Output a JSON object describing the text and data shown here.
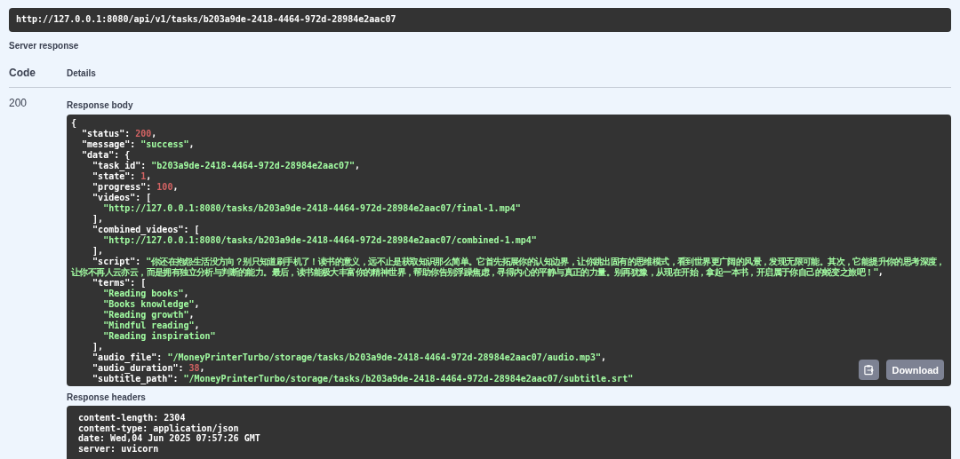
{
  "request_url": {
    "value": "http://127.0.0.1:8080/api/v1/tasks/b203a9de-2418-4464-972d-28984e2aac07"
  },
  "server_response": {
    "title": "Server response",
    "columns": [
      "Code",
      "Details"
    ],
    "code": "200",
    "response_body": {
      "label": "Response body",
      "lines": [
        [
          {
            "kind": "plain",
            "text": "{"
          }
        ],
        [
          {
            "kind": "plain",
            "text": "  \"status\": "
          },
          {
            "kind": "number",
            "text": "200"
          },
          {
            "kind": "plain",
            "text": ","
          }
        ],
        [
          {
            "kind": "plain",
            "text": "  \"message\": "
          },
          {
            "kind": "string",
            "text": "\"success\""
          },
          {
            "kind": "plain",
            "text": ","
          }
        ],
        [
          {
            "kind": "plain",
            "text": "  \"data\": {"
          }
        ],
        [
          {
            "kind": "plain",
            "text": "    \"task_id\": "
          },
          {
            "kind": "string",
            "text": "\"b203a9de-2418-4464-972d-28984e2aac07\""
          },
          {
            "kind": "plain",
            "text": ","
          }
        ],
        [
          {
            "kind": "plain",
            "text": "    \"state\": "
          },
          {
            "kind": "number",
            "text": "1"
          },
          {
            "kind": "plain",
            "text": ","
          }
        ],
        [
          {
            "kind": "plain",
            "text": "    \"progress\": "
          },
          {
            "kind": "number",
            "text": "100"
          },
          {
            "kind": "plain",
            "text": ","
          }
        ],
        [
          {
            "kind": "plain",
            "text": "    \"videos\": ["
          }
        ],
        [
          {
            "kind": "string",
            "text": "      \"http://127.0.0.1:8080/tasks/b203a9de-2418-4464-972d-28984e2aac07/final-1.mp4\""
          }
        ],
        [
          {
            "kind": "plain",
            "text": "    ],"
          }
        ],
        [
          {
            "kind": "plain",
            "text": "    \"combined_videos\": ["
          }
        ],
        [
          {
            "kind": "string",
            "text": "      \"http://127.0.0.1:8080/tasks/b203a9de-2418-4464-972d-28984e2aac07/combined-1.mp4\""
          }
        ],
        [
          {
            "kind": "plain",
            "text": "    ],"
          }
        ],
        [
          {
            "kind": "plain",
            "text": "    \"script\": "
          },
          {
            "kind": "string",
            "text": "\"你还在抱怨生活没方向？别只知道刷手机了！读书的意义，远不止是获取知识那么简单。它首先拓展你的认知边界，让你跳出固有的思维模式，看到世界更广阔的风景，发现无限可能。其次，它能提升你的思考深度，让你不再人云亦云，而是拥有独立分析与判断的能力。最后，读书能极大丰富你的精神世界，帮助你告别浮躁焦虑，寻得内心的平静与真正的力量。别再犹豫，从现在开始，拿起一本书，开启属于你自己的蜕变之旅吧！\""
          },
          {
            "kind": "plain",
            "text": ","
          }
        ],
        [
          {
            "kind": "plain",
            "text": "    \"terms\": ["
          }
        ],
        [
          {
            "kind": "string",
            "text": "      \"Reading books\""
          },
          {
            "kind": "plain",
            "text": ","
          }
        ],
        [
          {
            "kind": "string",
            "text": "      \"Books knowledge\""
          },
          {
            "kind": "plain",
            "text": ","
          }
        ],
        [
          {
            "kind": "string",
            "text": "      \"Reading growth\""
          },
          {
            "kind": "plain",
            "text": ","
          }
        ],
        [
          {
            "kind": "string",
            "text": "      \"Mindful reading\""
          },
          {
            "kind": "plain",
            "text": ","
          }
        ],
        [
          {
            "kind": "string",
            "text": "      \"Reading inspiration\""
          }
        ],
        [
          {
            "kind": "plain",
            "text": "    ],"
          }
        ],
        [
          {
            "kind": "plain",
            "text": "    \"audio_file\": "
          },
          {
            "kind": "string",
            "text": "\"/MoneyPrinterTurbo/storage/tasks/b203a9de-2418-4464-972d-28984e2aac07/audio.mp3\""
          },
          {
            "kind": "plain",
            "text": ","
          }
        ],
        [
          {
            "kind": "plain",
            "text": "    \"audio_duration\": "
          },
          {
            "kind": "number",
            "text": "38"
          },
          {
            "kind": "plain",
            "text": ","
          }
        ],
        [
          {
            "kind": "plain",
            "text": "    \"subtitle_path\": "
          },
          {
            "kind": "string",
            "text": "\"/MoneyPrinterTurbo/storage/tasks/b203a9de-2418-4464-972d-28984e2aac07/subtitle.srt\""
          }
        ]
      ],
      "buttons": [
        {
          "kind": "copy"
        },
        {
          "kind": "download",
          "label": "Download"
        }
      ]
    },
    "response_headers": {
      "label": "Response headers",
      "lines": [
        "content-length: 2304",
        "content-type: application/json",
        "date: Wed,04 Jun 2025 07:57:26 GMT",
        "server: uvicorn"
      ]
    }
  }
}
